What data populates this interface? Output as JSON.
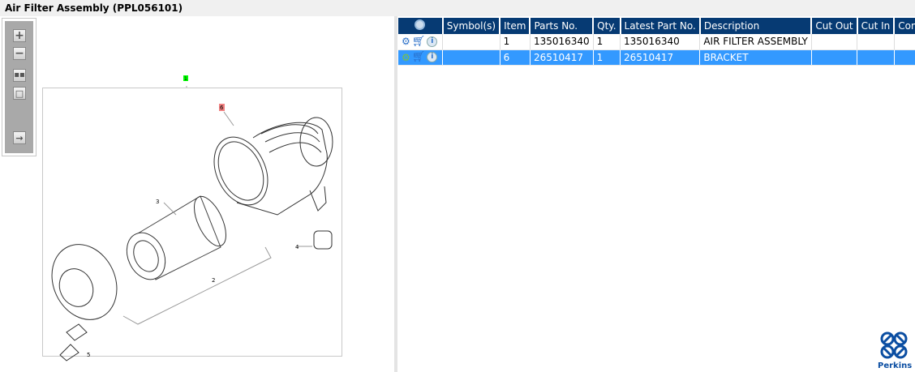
{
  "title": "Air Filter Assembly (PPL056101)",
  "toolbar": {
    "zoom_in": "zoom-in",
    "zoom_out": "zoom-out",
    "fit": "fit",
    "single": "single",
    "export": "export"
  },
  "drawing": {
    "callouts": [
      "1",
      "6",
      "3",
      "4",
      "2",
      "5"
    ],
    "selected_callout": "6"
  },
  "table": {
    "headers": [
      "Symbol(s)",
      "Item",
      "Parts No.",
      "Qty.",
      "Latest Part No.",
      "Description",
      "Cut Out",
      "Cut In",
      "Comment"
    ],
    "rows": [
      {
        "symbol": "",
        "item": "1",
        "parts_no": "135016340",
        "qty": "1",
        "latest": "135016340",
        "description": "AIR FILTER ASSEMBLY",
        "cut_out": "",
        "cut_in": "",
        "comment": "",
        "selected": false
      },
      {
        "symbol": "",
        "item": "6",
        "parts_no": "26510417",
        "qty": "1",
        "latest": "26510417",
        "description": "BRACKET",
        "cut_out": "",
        "cut_in": "",
        "comment": "",
        "selected": true
      }
    ]
  },
  "colors": {
    "header": "#063a73",
    "selected": "#3399ff",
    "callout_main": "#00ff00",
    "callout_selected": "#f08080"
  },
  "logo": {
    "text": "Perkins"
  }
}
